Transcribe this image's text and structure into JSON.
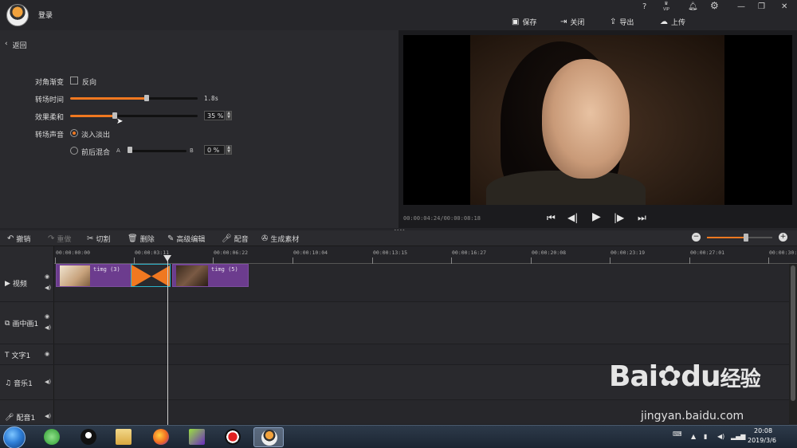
{
  "titlebar": {
    "login": "登录",
    "icons": [
      "question-icon",
      "vip-icon",
      "bell-icon",
      "gear-icon",
      "minimize-icon",
      "maximize-icon",
      "close-icon"
    ],
    "question_glyph": "?",
    "vip_label": "VIP",
    "buttons": {
      "save": "保存",
      "close": "关闭",
      "export": "导出",
      "upload": "上传"
    }
  },
  "left_panel": {
    "back": "返回",
    "diagonal_gradient": {
      "label": "对角渐变",
      "checkbox_label": "反向",
      "checked": false
    },
    "transition_time": {
      "label": "转场时间",
      "value": "1.8s",
      "fraction": 0.6
    },
    "effect_softness": {
      "label": "效果柔和",
      "value": "35 %",
      "fraction": 0.35
    },
    "transition_sound": {
      "label": "转场声音",
      "option_fade": "淡入淡出",
      "option_mix": "前后混合",
      "selected": "淡入淡出",
      "mix_a": "A",
      "mix_b": "B",
      "mix_value": "0 %",
      "mix_fraction": 0.0
    }
  },
  "preview": {
    "time": "00:00:04:24/00:00:08:18"
  },
  "edit_toolbar": {
    "undo": "撤销",
    "redo": "重做",
    "split": "切割",
    "delete": "删除",
    "advanced_edit": "高级编辑",
    "dub": "配音",
    "generate": "生成素材",
    "zoom_level": 0.6
  },
  "timeline": {
    "ruler": [
      "00:00:00:00",
      "00:00:03:11",
      "00:00:06:22",
      "00:00:10:04",
      "00:00:13:15",
      "00:00:16:27",
      "00:00:20:08",
      "00:00:23:19",
      "00:00:27:01",
      "00:00:30:"
    ],
    "tracks": [
      {
        "name": "视频",
        "icon": "play-icon"
      },
      {
        "name": "画中画1",
        "icon": "pip-icon"
      },
      {
        "name": "文字1",
        "icon": "text-icon"
      },
      {
        "name": "音乐1",
        "icon": "music-icon"
      },
      {
        "name": "配音1",
        "icon": "mic-icon"
      }
    ],
    "clips": [
      {
        "label": "timg (3)"
      },
      {
        "label": "timg (5)"
      }
    ]
  },
  "taskbar": {
    "time": "20:08",
    "date": "2019/3/6"
  },
  "watermark": {
    "text": "Bai",
    "text2": "du",
    "text3": "经验",
    "url": "jingyan.baidu.com"
  },
  "colors": {
    "accent": "#f07820",
    "clip": "#6c3c8e",
    "transition_border": "#2bb3c9"
  }
}
